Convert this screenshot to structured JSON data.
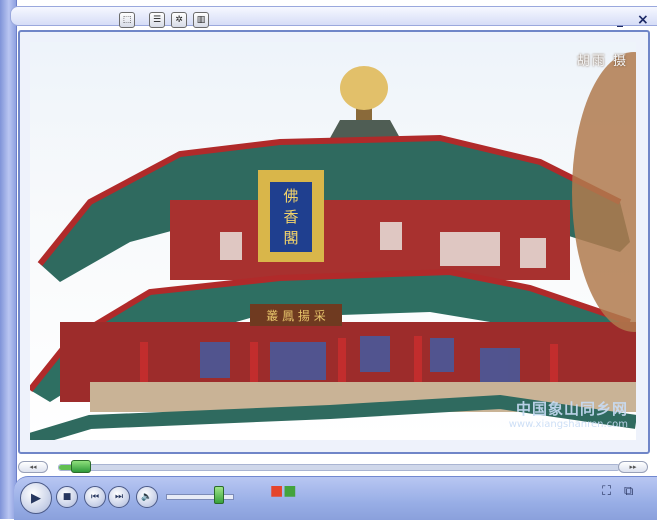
{
  "titlebar": {
    "icons": [
      "playlist-icon",
      "menu-icon",
      "visualization-icon",
      "equalizer-icon"
    ],
    "glyphs": [
      "⬚",
      "☰",
      "✲",
      "▥"
    ],
    "minimize": "_",
    "close": "×"
  },
  "video": {
    "credit": "胡雨 摄",
    "watermark_main": "中国象山同乡网",
    "watermark_url": "www.xiangshanren.com",
    "building": {
      "plaque_text": "佛香閣",
      "lower_plaque_text": "叢 鳳 揚 采"
    }
  },
  "seek": {
    "back_label": "◂◂",
    "forward_label": "▸▸",
    "progress": 0.03
  },
  "controls": {
    "play_glyph": "▶",
    "stop_glyph": "■",
    "prev_glyph": "⏮",
    "next_glyph": "⏭",
    "mute_glyph": "🔈",
    "volume": 0.79,
    "fullscreen_glyph": "⛶",
    "switch_glyph": "⧉"
  },
  "colors": {
    "chrome_blue": "#98aee6",
    "accent_green": "#3aa63c",
    "roof_teal": "#2f7a6d",
    "wall_red": "#b02a2a",
    "gold": "#d9b64a"
  }
}
